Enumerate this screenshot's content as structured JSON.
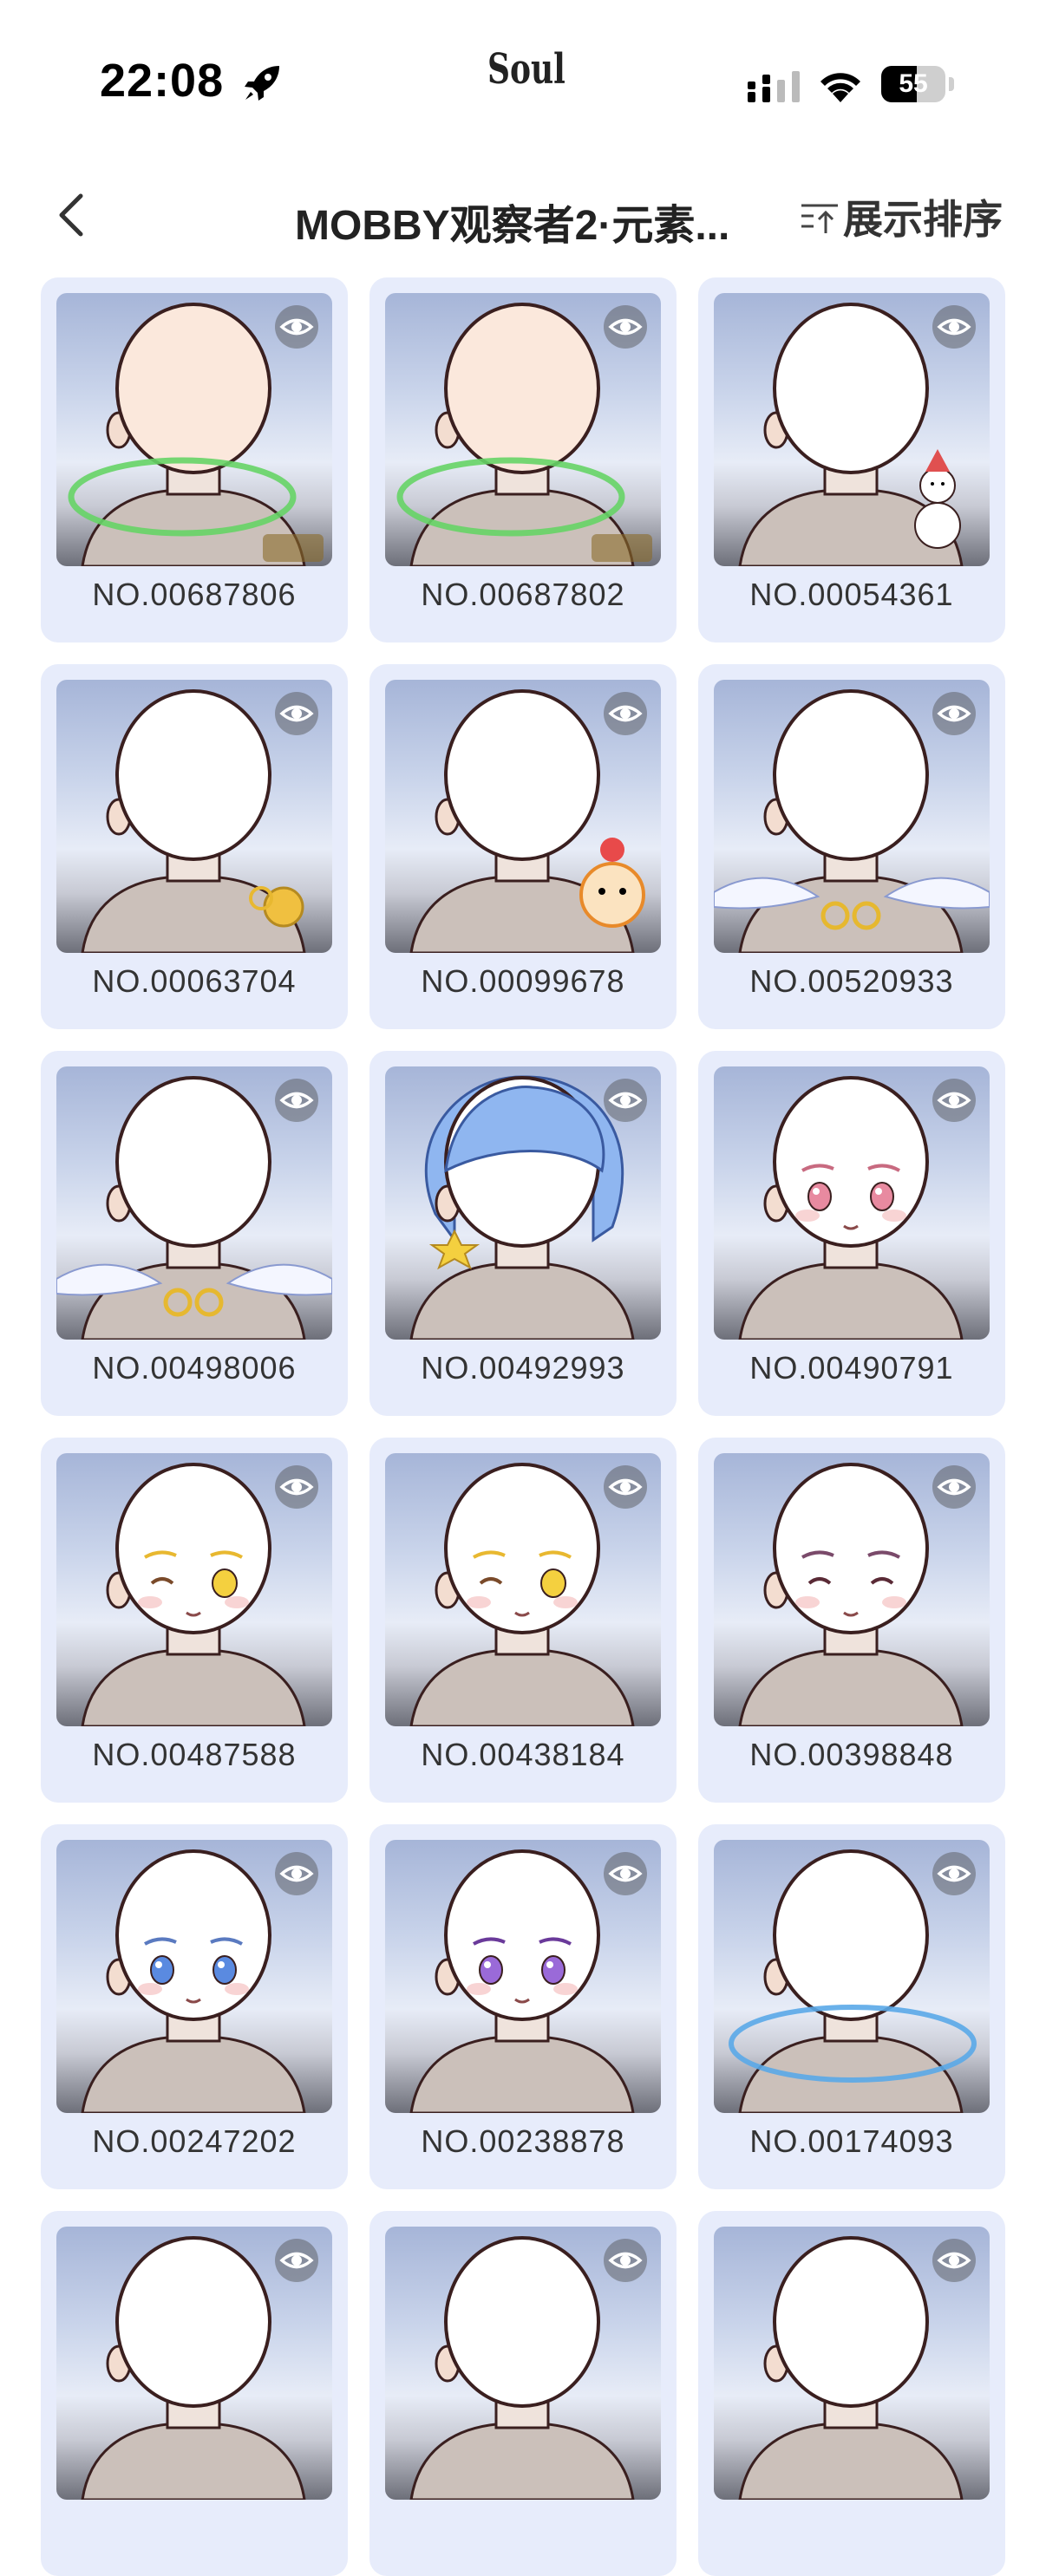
{
  "status_bar": {
    "time": "22:08",
    "app_logo": "Soul",
    "battery_level": "55",
    "icons": [
      "rocket-icon",
      "signal-icon",
      "wifi-icon",
      "battery-icon"
    ]
  },
  "header": {
    "title": "MOBBY观察者2·元素...",
    "sort_label": "展示排序",
    "back_icon": "chevron-left-icon",
    "sort_icon": "sort-icon"
  },
  "cards": [
    {
      "id": "NO.00687806",
      "variant": "green-ring-peach"
    },
    {
      "id": "NO.00687802",
      "variant": "green-ring-peach"
    },
    {
      "id": "NO.00054361",
      "variant": "snowman"
    },
    {
      "id": "NO.00063704",
      "variant": "gold-hand"
    },
    {
      "id": "NO.00099678",
      "variant": "orange-mascot"
    },
    {
      "id": "NO.00520933",
      "variant": "wings-gold"
    },
    {
      "id": "NO.00498006",
      "variant": "wings-gold"
    },
    {
      "id": "NO.00492993",
      "variant": "blue-hair"
    },
    {
      "id": "NO.00490791",
      "variant": "pink-eyes"
    },
    {
      "id": "NO.00487588",
      "variant": "yellow-wink"
    },
    {
      "id": "NO.00438184",
      "variant": "yellow-wink"
    },
    {
      "id": "NO.00398848",
      "variant": "closed-eyes"
    },
    {
      "id": "NO.00247202",
      "variant": "blue-eyes"
    },
    {
      "id": "NO.00238878",
      "variant": "purple-eyes"
    },
    {
      "id": "NO.00174093",
      "variant": "blue-ring"
    },
    {
      "id": "",
      "variant": "plain"
    },
    {
      "id": "",
      "variant": "plain"
    },
    {
      "id": "",
      "variant": "plain"
    }
  ]
}
